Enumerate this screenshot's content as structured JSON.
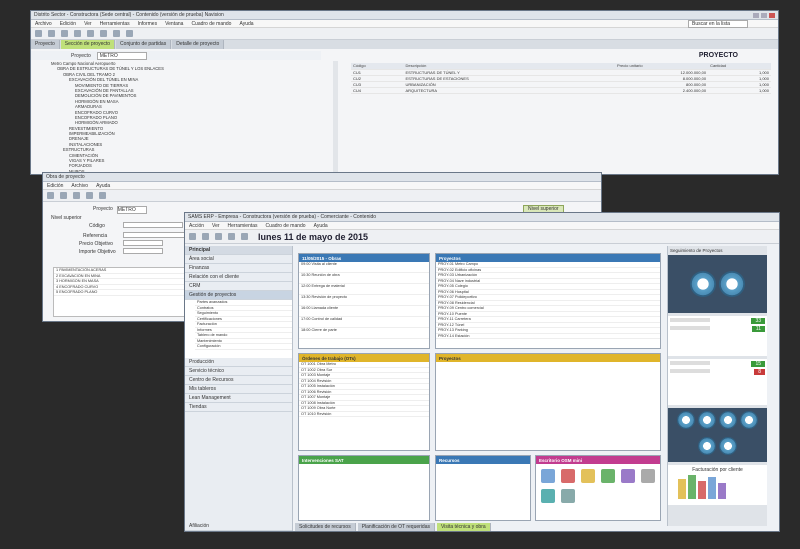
{
  "win1": {
    "title": "Distrito Sector - Constructora (Sede central) - Contenido (versión de prueba) Navision",
    "menu": [
      "Archivo",
      "Edición",
      "Ver",
      "Herramientas",
      "Informes",
      "Ventana",
      "Cuadro de mando",
      "Ayuda"
    ],
    "search": "Buscar en la lista",
    "tabs": [
      "Proyecto",
      "Sección de proyecto",
      "Conjunto de partidas",
      "Detalle de proyecto"
    ],
    "proyecto_header": "PROYECTO",
    "proyecto_label": "Proyecto",
    "proyecto_value": "METRO",
    "tree": [
      "Metro Campo Nacional Aeropuerto",
      "OBRA DE ESTRUCTURAS DE TÚNEL Y LOS ENLACES",
      "OBRA CIVIL DEL TRAMO 2",
      "EXCAVACIÓN DEL TÚNEL EN MINA",
      "MOVIMIENTO DE TIERRAS",
      "EXCAVACIÓN DE PANTALLAS",
      "DEMOLICIÓN DE PAVIMENTOS",
      "HORMIGÓN EN MASA",
      "ARMADURAS",
      "ENCOFRADO CURVO",
      "ENCOFRADO PLANO",
      "HORMIGÓN ARMADO",
      "REVESTIMIENTO",
      "IMPERMEABILIZACIÓN",
      "DRENAJE",
      "INSTALACIONES",
      "ESTRUCTURAS",
      "CIMENTACIÓN",
      "VIGAS Y PILARES",
      "FORJADOS",
      "MUROS",
      "URBANIZACIÓN",
      "FIRME",
      "ACERAS",
      "SEÑALIZACIÓN",
      "GESTIÓN DE RESIDUOS",
      "SEGURIDAD Y SALUD"
    ],
    "table": {
      "headers": [
        "Código",
        "Descripción",
        "Precio unitario",
        "Cantidad"
      ],
      "rows": [
        [
          "CU1",
          "ESTRUCTURAS DE TÚNEL Y",
          "12.000.000,00",
          "1,000"
        ],
        [
          "CU2",
          "ESTRUCTURAS DE ESTACIONES",
          "8.000.000,00",
          "1,000"
        ],
        [
          "CU3",
          "URBANIZACIÓN",
          "800.000,00",
          "1,000"
        ],
        [
          "CU4",
          "ARQUITECTURA",
          "2.400.000,00",
          "1,000"
        ]
      ]
    }
  },
  "win2": {
    "title": "Obra de proyecto",
    "menu": [
      "Edición",
      "Archivo",
      "Ayuda"
    ],
    "field_proyecto": "Proyecto",
    "field_proyecto_val": "METRO",
    "field_sup": "Nivel superior",
    "field_codigo": "Código",
    "field_ref": "Referencia",
    "field_precio": "Precio Objetivo",
    "field_importe": "Importe Objetivo",
    "nivel_btn": "Nivel superior",
    "rows": [
      [
        "1",
        "PAVIMENTACIÓN",
        "ACERAS"
      ],
      [
        "2",
        "EXCAVACIÓN",
        "EN MINA"
      ],
      [
        "3",
        "HORMIGÓN",
        "EN MASA"
      ],
      [
        "4",
        "ENCOFRADO",
        "CURVO"
      ],
      [
        "5",
        "ENCOFRADO",
        "PLANO"
      ]
    ]
  },
  "win3": {
    "title": "SAMS ERP - Empresa - Constructora (versión de prueba) - Comerciante - Contenido",
    "menu": [
      "Acción",
      "Ver",
      "Herramientas",
      "Cuadro de mando",
      "Ayuda"
    ],
    "date": "lunes 11 de mayo de 2015",
    "principal": "Principal",
    "sidebar_items": [
      "Área social",
      "Finanzas",
      "Relación con el cliente",
      "CRM",
      "Gestión de proyectos",
      "Producción",
      "Servicio técnico",
      "Centro de Recursos",
      "Mis tableros",
      "Lean Management",
      "Tiendas"
    ],
    "tree_items": [
      "Partes avanzados",
      "Contratos",
      "Seguimiento",
      "Certificaciones",
      "Facturación",
      "Informes",
      "Tablero de mando",
      "Mantenimiento",
      "Configuración"
    ],
    "panels": {
      "agenda": "11/05/2015 - Obras",
      "ot": "Órdenes de trabajo (OTs)",
      "proyectos": "Proyectos",
      "interv": "Intervenciones SAT",
      "recursos": "Recursos",
      "escritorio": "Escritorio OSM mini",
      "seguimiento": "Seguimiento de Proyectos",
      "facturacion": "Facturación por cliente"
    },
    "tabs_bottom": [
      "Solicitudes de recursos",
      "Planificación de OT requeridas",
      "Visita técnica y obra"
    ],
    "bottom_left": "Afiliación",
    "agenda_rows": [
      "09:00 Visita al cliente",
      "10:30 Reunión de obra",
      "12:00 Entrega de material",
      "13:30 Revisión de proyecto",
      "16:00 Llamada cliente",
      "17:00 Control de calidad",
      "18:00 Cierre de parte"
    ],
    "ot_rows": [
      "OT 1001 Obra Metro",
      "OT 1002 Obra Sur",
      "OT 1003 Montaje",
      "OT 1004 Revisión",
      "OT 1005 Instalación",
      "OT 1006 Revisión",
      "OT 1007 Montaje",
      "OT 1008 Instalación",
      "OT 1009 Obra Norte",
      "OT 1010 Revisión"
    ],
    "proj_rows": [
      "PROY-01 Metro Campo",
      "PROY-02 Edificio oficinas",
      "PROY-03 Urbanización",
      "PROY-04 Nave industrial",
      "PROY-05 Colegio",
      "PROY-06 Hospital",
      "PROY-07 Polideportivo",
      "PROY-08 Residencial",
      "PROY-09 Centro comercial",
      "PROY-10 Puente",
      "PROY-11 Carretera",
      "PROY-12 Túnel",
      "PROY-13 Parking",
      "PROY-14 Estación",
      "PROY-15 Almacén"
    ],
    "kpi_values": [
      "33",
      "11",
      "15",
      "8"
    ],
    "chart_labels": [
      "Facturación por cliente",
      "Facturación por unidad de trabajo"
    ]
  }
}
